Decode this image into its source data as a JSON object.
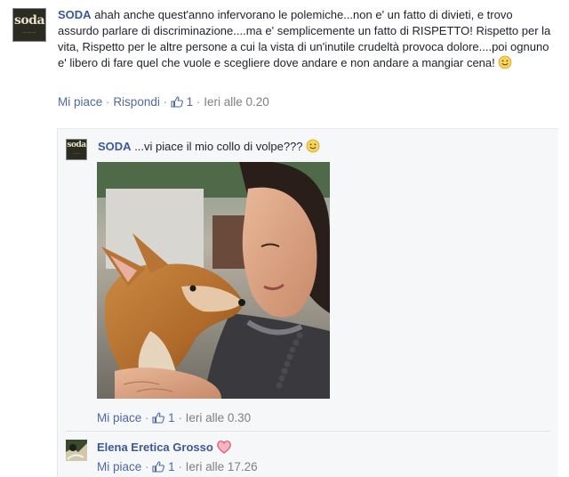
{
  "comments": [
    {
      "author": "SODA",
      "avatar_label": "soda",
      "text": "ahah anche quest'anno infervorano le polemiche...non e' un fatto di divieti, e trovo assurdo parlare di discriminazione....ma e' semplicemente un fatto di RISPETTO! Rispetto per la vita, Rispetto per le altre persone a cui la vista di un'inutile crudeltà provoca dolore....poi ognuno e' libero di fare quel che vuole e scegliere dove andare e non andare a mangiar cena!",
      "like_label": "Mi piace",
      "reply_label": "Rispondi",
      "likes": "1",
      "timestamp": "Ieri alle 0.20"
    },
    {
      "author": "SODA",
      "avatar_label": "soda",
      "text": "...vi piace il mio collo di volpe???",
      "like_label": "Mi piace",
      "likes": "1",
      "timestamp": "Ieri alle 0.30"
    },
    {
      "author": "Elena Eretica Grosso",
      "like_label": "Mi piace",
      "likes": "1",
      "timestamp": "Ieri alle 17.26"
    }
  ],
  "meta_separator": "·",
  "colors": {
    "link": "#3b5998",
    "meta": "#7f7f7f",
    "panel": "#f6f7f9",
    "heart": "#e0566d"
  },
  "icons": [
    "thumbs-up-icon",
    "smiley-icon",
    "heart-icon"
  ]
}
